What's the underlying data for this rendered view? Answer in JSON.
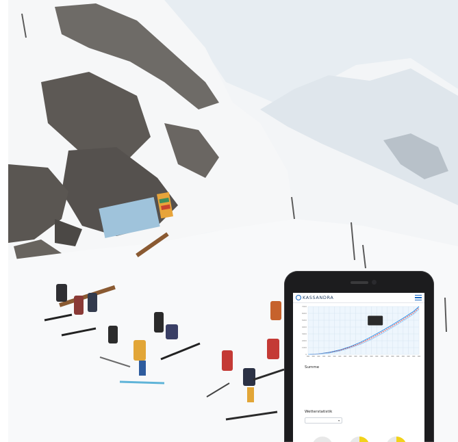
{
  "app": {
    "brand": "KASSANDRA"
  },
  "chart_data": {
    "type": "line",
    "title": "",
    "xlabel": "",
    "ylabel": "",
    "y_ticks": [
      "7000",
      "6000",
      "5000",
      "4000",
      "3000",
      "2000",
      "1000",
      "0"
    ],
    "ylim": [
      0,
      7000
    ],
    "x_tick_count": 22,
    "grid": true,
    "tooltip": {
      "lines": [
        "",
        "",
        ""
      ]
    },
    "series": [
      {
        "name": "",
        "color": "#1e88e5",
        "dash": false,
        "x": [
          0,
          2,
          4,
          6,
          8,
          10,
          12,
          14,
          16,
          18,
          20,
          21
        ],
        "y": [
          0,
          80,
          300,
          650,
          1150,
          1800,
          2600,
          3450,
          4350,
          5300,
          6300,
          7000
        ]
      },
      {
        "name": "",
        "color": "#e53935",
        "dash": true,
        "x": [
          0,
          2,
          4,
          6,
          8,
          10,
          12,
          14,
          16,
          18,
          20,
          21
        ],
        "y": [
          0,
          60,
          250,
          580,
          1050,
          1650,
          2400,
          3250,
          4150,
          5100,
          6100,
          6800
        ]
      },
      {
        "name": "",
        "color": "#90caf9",
        "dash": false,
        "x": [
          0,
          2,
          4,
          6,
          8,
          10,
          12,
          14,
          16,
          18,
          20,
          21
        ],
        "y": [
          0,
          40,
          200,
          500,
          950,
          1500,
          2200,
          3050,
          3950,
          4900,
          5900,
          6600
        ]
      }
    ]
  },
  "summary": {
    "title": "Summe",
    "rows": [
      {
        "label": "",
        "value": ""
      },
      {
        "label": "",
        "value": ""
      },
      {
        "label": "",
        "value": ""
      }
    ]
  },
  "weather": {
    "title": "Wetterstatistik",
    "select": {
      "value": ""
    },
    "columns": [
      {
        "label": ""
      },
      {
        "label": ""
      },
      {
        "label": ""
      }
    ],
    "gauges": [
      {
        "color": "#dcdcdc",
        "level": 0.0
      },
      {
        "color": "#f2d21a",
        "level": 0.6
      },
      {
        "color": "#f2d21a",
        "level": 0.35
      }
    ]
  }
}
